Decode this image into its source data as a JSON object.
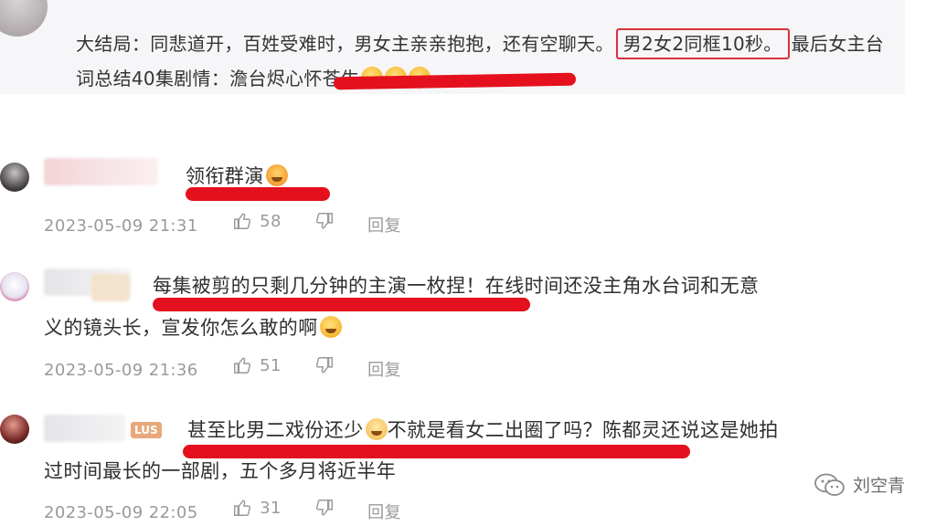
{
  "top_reply": {
    "text_part1": "大结局：同悲道开，百姓受难时，男女主亲亲抱抱，还有空聊天。",
    "highlight": "男2女2同框10秒。",
    "text_part2": "最后女主台词总结40集剧情：",
    "underlined": "澹台烬心怀苍生"
  },
  "comments": [
    {
      "text": "领衔群演",
      "time": "2023-05-09 21:31",
      "likes": "58",
      "reply_label": "回复"
    },
    {
      "text_line1": "每集被剪的只剩几分钟的主演一枚捏！在线时间还没主角水台词和无意",
      "text_line2": "义的镜头长，宣发你怎么敢的啊",
      "time": "2023-05-09 21:36",
      "likes": "51",
      "reply_label": "回复"
    },
    {
      "badge": "LUS",
      "text_line1a": "甚至比男二戏份还少",
      "text_line1b": "不就是看女二出圈了吗？陈都灵还说这是她拍",
      "text_line2": "过时间最长的一部剧，五个多月将近半年",
      "time": "2023-05-09 22:05",
      "likes": "31",
      "reply_label": "回复"
    }
  ],
  "watermark": {
    "text": "刘空青"
  },
  "colors": {
    "underline": "#e5101d",
    "box": "#d8323a",
    "meta": "#9a9a9a"
  }
}
